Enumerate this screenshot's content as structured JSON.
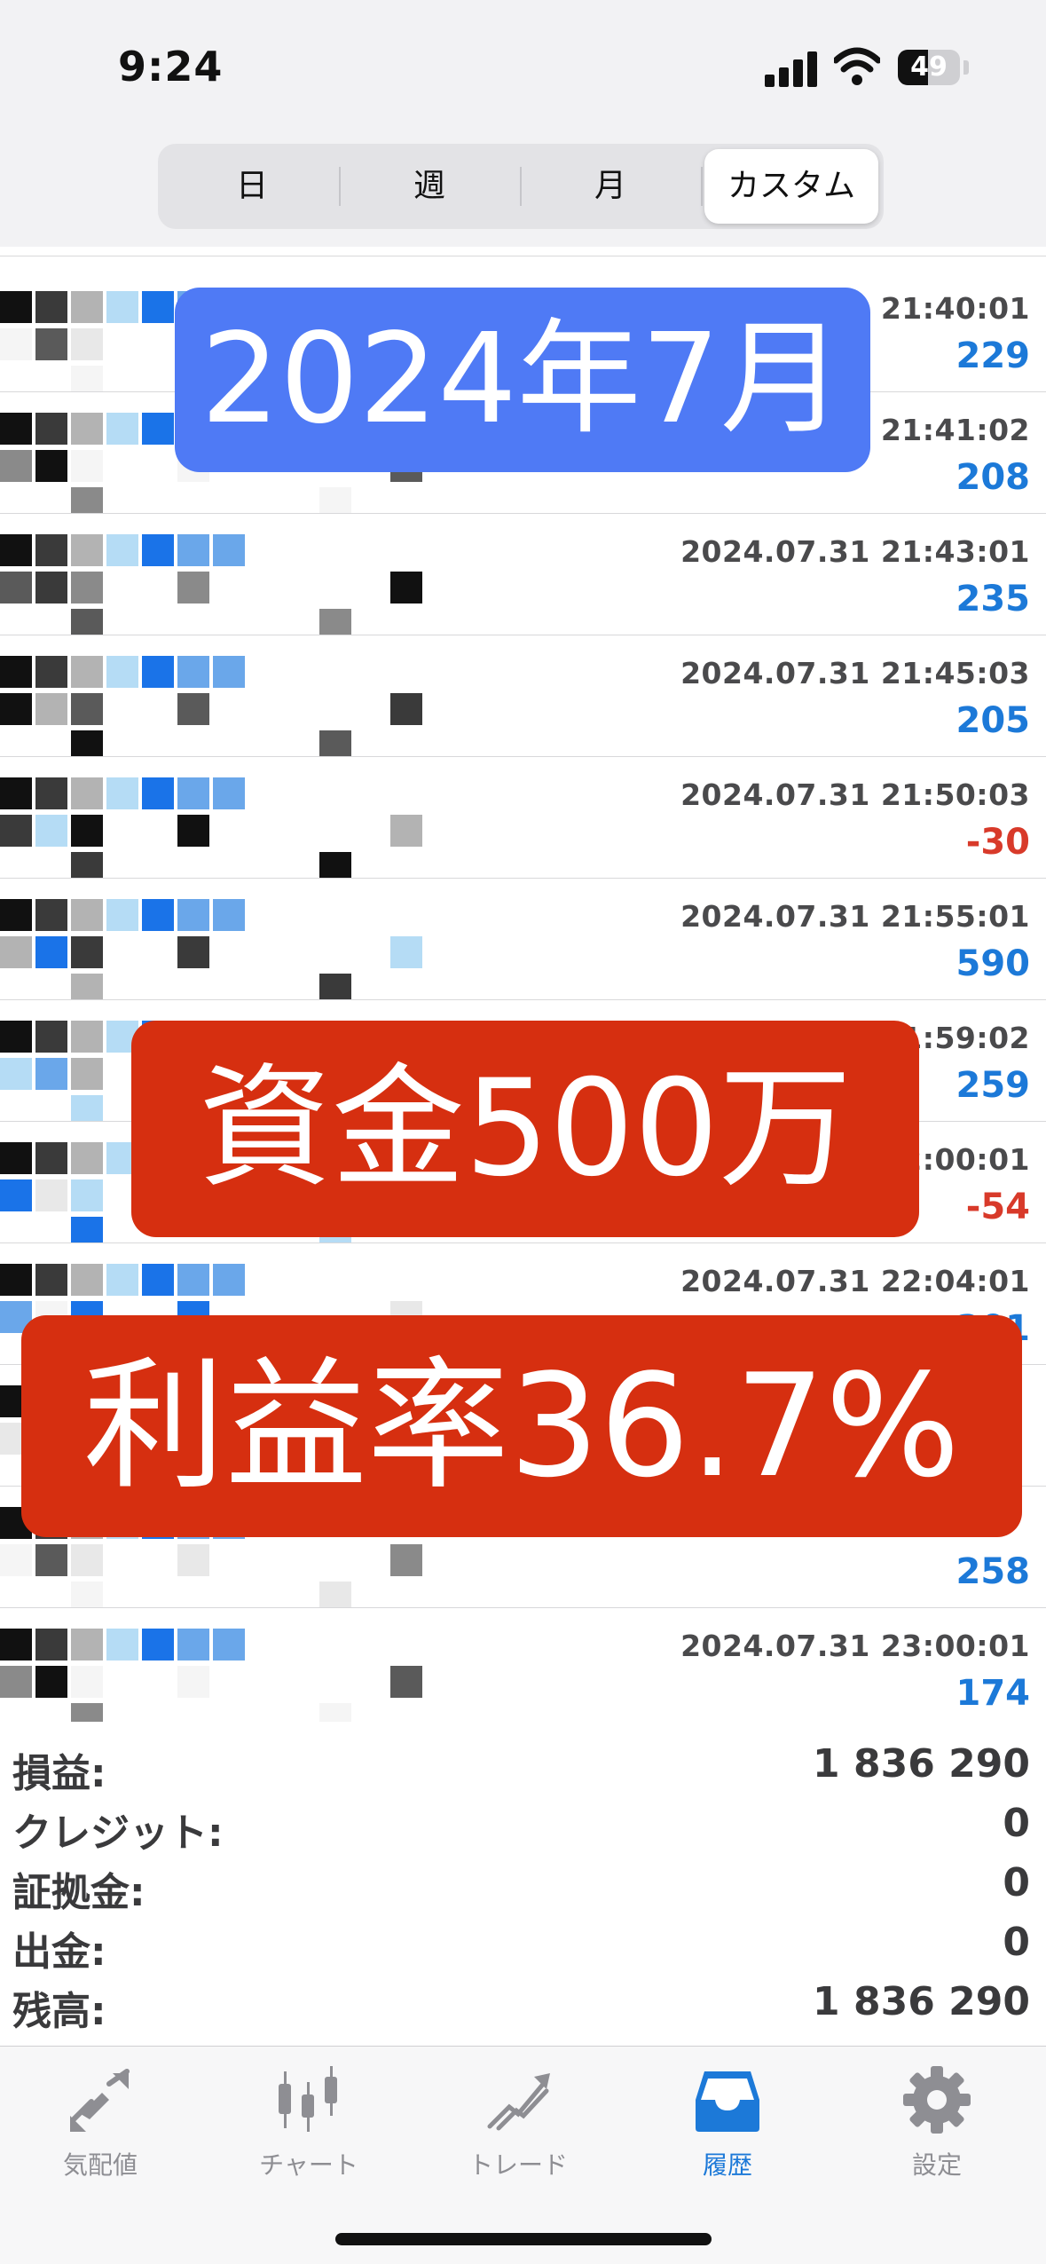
{
  "status_bar": {
    "time": "9:24",
    "battery": "49",
    "battery_level": 0.49
  },
  "segments": [
    {
      "label": "日",
      "selected": false
    },
    {
      "label": "週",
      "selected": false
    },
    {
      "label": "月",
      "selected": false
    },
    {
      "label": "カスタム",
      "selected": true
    }
  ],
  "top_partial_value": "208",
  "deals": [
    {
      "datetime": "2024.07.31 21:40:01",
      "profit": "229",
      "negative": false
    },
    {
      "datetime": "2024.07.31 21:41:02",
      "profit": "208",
      "negative": false
    },
    {
      "datetime": "2024.07.31 21:43:01",
      "profit": "235",
      "negative": false
    },
    {
      "datetime": "2024.07.31 21:45:03",
      "profit": "205",
      "negative": false
    },
    {
      "datetime": "2024.07.31 21:50:03",
      "profit": "-30",
      "negative": true
    },
    {
      "datetime": "2024.07.31 21:55:01",
      "profit": "590",
      "negative": false
    },
    {
      "datetime": "2024.07.31 21:59:02",
      "profit": "259",
      "negative": false
    },
    {
      "datetime": "2024.07.31 22:00:01",
      "profit": "-54",
      "negative": true
    },
    {
      "datetime": "2024.07.31 22:04:01",
      "profit": "201",
      "negative": false
    },
    {
      "datetime": "",
      "profit": "",
      "negative": false
    },
    {
      "datetime": "",
      "profit": "258",
      "negative": false
    },
    {
      "datetime": "2024.07.31 23:00:01",
      "profit": "174",
      "negative": false
    }
  ],
  "overlays": {
    "month": "2024年7月",
    "capital": "資金500万",
    "profit_rate": "利益率36.7%"
  },
  "summary": [
    {
      "label": "損益:",
      "value": "1 836 290"
    },
    {
      "label": "クレジット:",
      "value": "0"
    },
    {
      "label": "証拠金:",
      "value": "0"
    },
    {
      "label": "出金:",
      "value": "0"
    },
    {
      "label": "残高:",
      "value": "1 836 290"
    }
  ],
  "tabs": [
    {
      "label": "気配値",
      "icon": "quotes-icon",
      "active": false
    },
    {
      "label": "チャート",
      "icon": "chart-icon",
      "active": false
    },
    {
      "label": "トレード",
      "icon": "trade-icon",
      "active": false
    },
    {
      "label": "履歴",
      "icon": "history-icon",
      "active": true
    },
    {
      "label": "設定",
      "icon": "settings-icon",
      "active": false
    }
  ],
  "colors": {
    "positive": "#1c79d8",
    "negative": "#d83a2a",
    "overlay_blue": "#4f7af5",
    "overlay_red": "#d62f10",
    "tab_active": "#1c79d8",
    "tab_inactive": "#8e8e93"
  }
}
